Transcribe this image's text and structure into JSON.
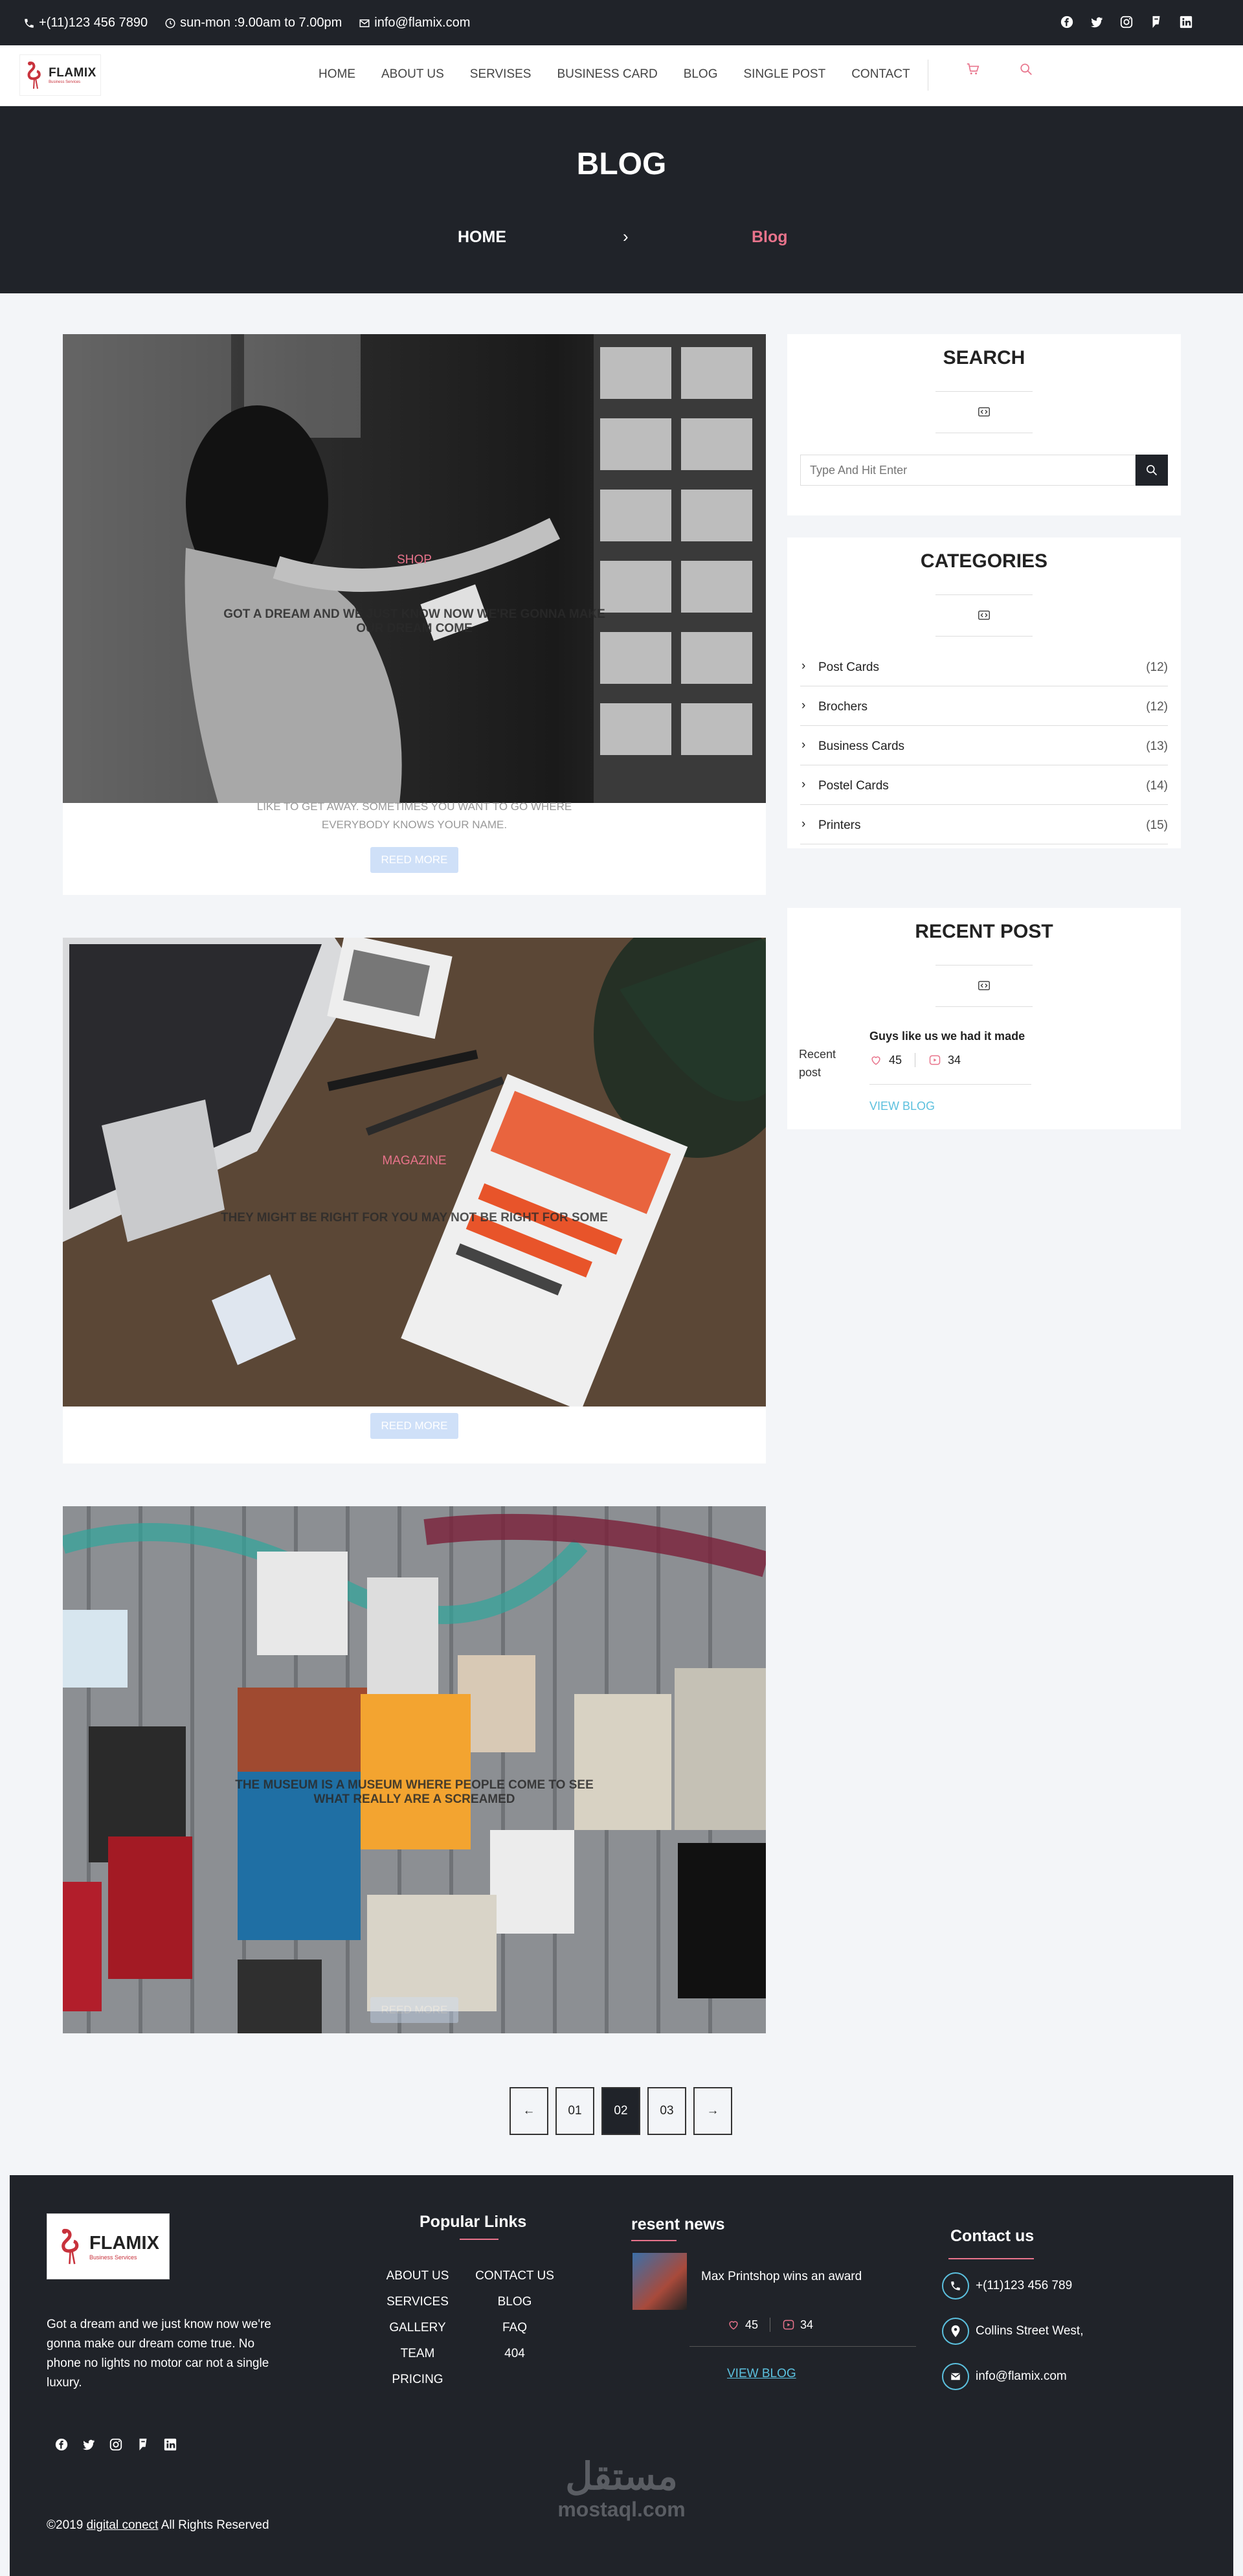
{
  "topbar": {
    "phone": "+(11)123 456 7890",
    "hours": "sun-mon :9.00am to 7.00pm",
    "email": "info@flamix.com"
  },
  "logo": {
    "text": "FLAMIX",
    "tagline": "Business Services"
  },
  "nav": {
    "items": [
      "HOME",
      "ABOUT US",
      "SERVISES",
      "BUSINESS CARD",
      "BLOG",
      "SINGLE POST",
      "CONTACT"
    ]
  },
  "hero": {
    "title": "BLOG",
    "crumb_home": "HOME",
    "crumb_current": "Blog"
  },
  "posts": [
    {
      "category": "SHOP",
      "title": "GOT A DREAM AND WE JUST KNOW NOW WE'RE GONNA MAKE OUR DREAM COME",
      "excerpt": "LIKE TO GET AWAY. SOMETIMES YOU WANT TO GO WHERE EVERYBODY KNOWS YOUR NAME.",
      "read_more": "REED MORE"
    },
    {
      "category": "MAGAZINE",
      "title": "THEY MIGHT BE RIGHT FOR YOU MAY NOT BE RIGHT FOR SOME",
      "read_more": "REED MORE"
    },
    {
      "title": "THE MUSEUM IS A MUSEUM WHERE PEOPLE COME TO SEE WHAT REALLY ARE A SCREAMED",
      "read_more": "REED MORE"
    }
  ],
  "sidebar": {
    "search": {
      "title": "SEARCH",
      "placeholder": "Type And Hit Enter"
    },
    "categories": {
      "title": "CATEGORIES",
      "items": [
        {
          "name": "Post Cards",
          "count": "(12)"
        },
        {
          "name": "Brochers",
          "count": "(12)"
        },
        {
          "name": "Business Cards",
          "count": "(13)"
        },
        {
          "name": "Postel Cards",
          "count": "(14)"
        },
        {
          "name": "Printers",
          "count": "(15)"
        }
      ]
    },
    "recent": {
      "title": "RECENT POST",
      "img_alt": "Recent post",
      "post_title": "Guys like us we had it made",
      "likes": "45",
      "views": "34",
      "view_blog": "VIEW BLOG"
    }
  },
  "pagination": {
    "prev": "←",
    "pages": [
      "01",
      "02",
      "03"
    ],
    "next": "→",
    "active": "02"
  },
  "footer": {
    "about": "Got a dream and we just know now we're gonna make our dream come true. No phone no lights no motor car not a single luxury.",
    "popular_title": "Popular Links",
    "links_left": [
      "ABOUT US",
      "SERVICES",
      "GALLERY",
      "TEAM",
      "PRICING"
    ],
    "links_right": [
      "CONTACT US",
      "BLOG",
      "FAQ",
      "404"
    ],
    "news_title": "resent news",
    "news_item": "Max Printshop wins an award",
    "news_likes": "45",
    "news_views": "34",
    "view_blog": "VIEW BLOG",
    "contact_title": "Contact us",
    "contact_phone": "+(11)123 456 789",
    "contact_address": "Collins Street West,",
    "contact_email": "info@flamix.com",
    "copyright_pre": "©2019",
    "copyright_link": "digital conect",
    "copyright_post": "All Rights Reserved",
    "watermark_ar": "مستقل",
    "watermark_en": "mostaql.com"
  },
  "colors": {
    "dark": "#202329",
    "accent": "#e8738b",
    "link": "#5bc0de"
  }
}
